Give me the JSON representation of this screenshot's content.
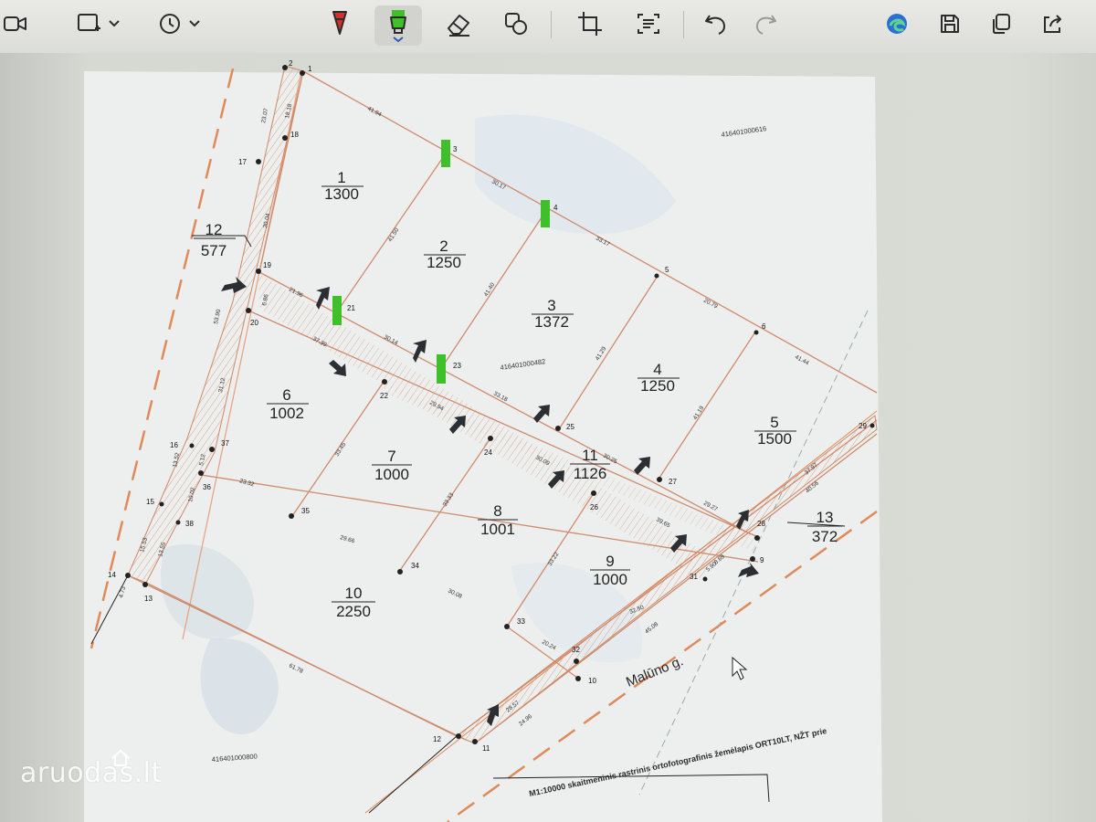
{
  "toolbar": {
    "icons": [
      "video-camera-icon",
      "rectangle-select-icon",
      "timer-icon",
      "pen-icon",
      "highlighter-icon",
      "eraser-icon",
      "shapes-icon",
      "crop-icon",
      "text-recognition-icon",
      "undo-icon",
      "redo-icon",
      "edge-icon",
      "save-icon",
      "copy-icon",
      "share-icon"
    ],
    "highlighter_color": "#3fbf2a",
    "pen_color": "#d0312d"
  },
  "map": {
    "parcel_codes": [
      "416401000616",
      "416401000482",
      "416401000800"
    ],
    "street": "Malūno g.",
    "footer_text": "M1:10000 skaitmeninis rastrinis ortofotografinis žemėlapis ORT10LT, NŽT prie",
    "plots": [
      {
        "num": "1",
        "area": "1300"
      },
      {
        "num": "2",
        "area": "1250"
      },
      {
        "num": "3",
        "area": "1372"
      },
      {
        "num": "4",
        "area": "1250"
      },
      {
        "num": "5",
        "area": "1500"
      },
      {
        "num": "6",
        "area": "1002"
      },
      {
        "num": "7",
        "area": "1000"
      },
      {
        "num": "8",
        "area": "1001"
      },
      {
        "num": "9",
        "area": "1000"
      },
      {
        "num": "10",
        "area": "2250"
      },
      {
        "num": "11",
        "area": "1126"
      },
      {
        "num": "12",
        "area": "577"
      },
      {
        "num": "13",
        "area": "372"
      }
    ],
    "points": [
      "1",
      "2",
      "3",
      "4",
      "5",
      "6",
      "9",
      "10",
      "11",
      "12",
      "13",
      "14",
      "15",
      "16",
      "17",
      "18",
      "19",
      "20",
      "21",
      "22",
      "23",
      "24",
      "25",
      "26",
      "27",
      "28",
      "29",
      "31",
      "32",
      "33",
      "34",
      "35",
      "36",
      "37",
      "38"
    ],
    "dimensions": [
      "23.07",
      "18.18",
      "41.94",
      "30.17",
      "33.17",
      "20.79",
      "41.44",
      "30.04",
      "41.50",
      "41.40",
      "41.29",
      "41.19",
      "21.36",
      "30.14",
      "33.18",
      "30.25",
      "53.90",
      "6.86",
      "37.39",
      "29.94",
      "30.09",
      "29.27",
      "31.12",
      "33.45",
      "33.33",
      "33.22",
      "39.65",
      "37.97",
      "13.52",
      "10.02",
      "5.12",
      "23.32",
      "29.66",
      "30.08",
      "32.50",
      "15.53",
      "13.55",
      "4.73",
      "61.78",
      "28.57",
      "20.24",
      "24.96",
      "45.08",
      "40.56",
      "8.69",
      "5.90"
    ]
  },
  "watermark": {
    "text": "aruodas.lt"
  }
}
